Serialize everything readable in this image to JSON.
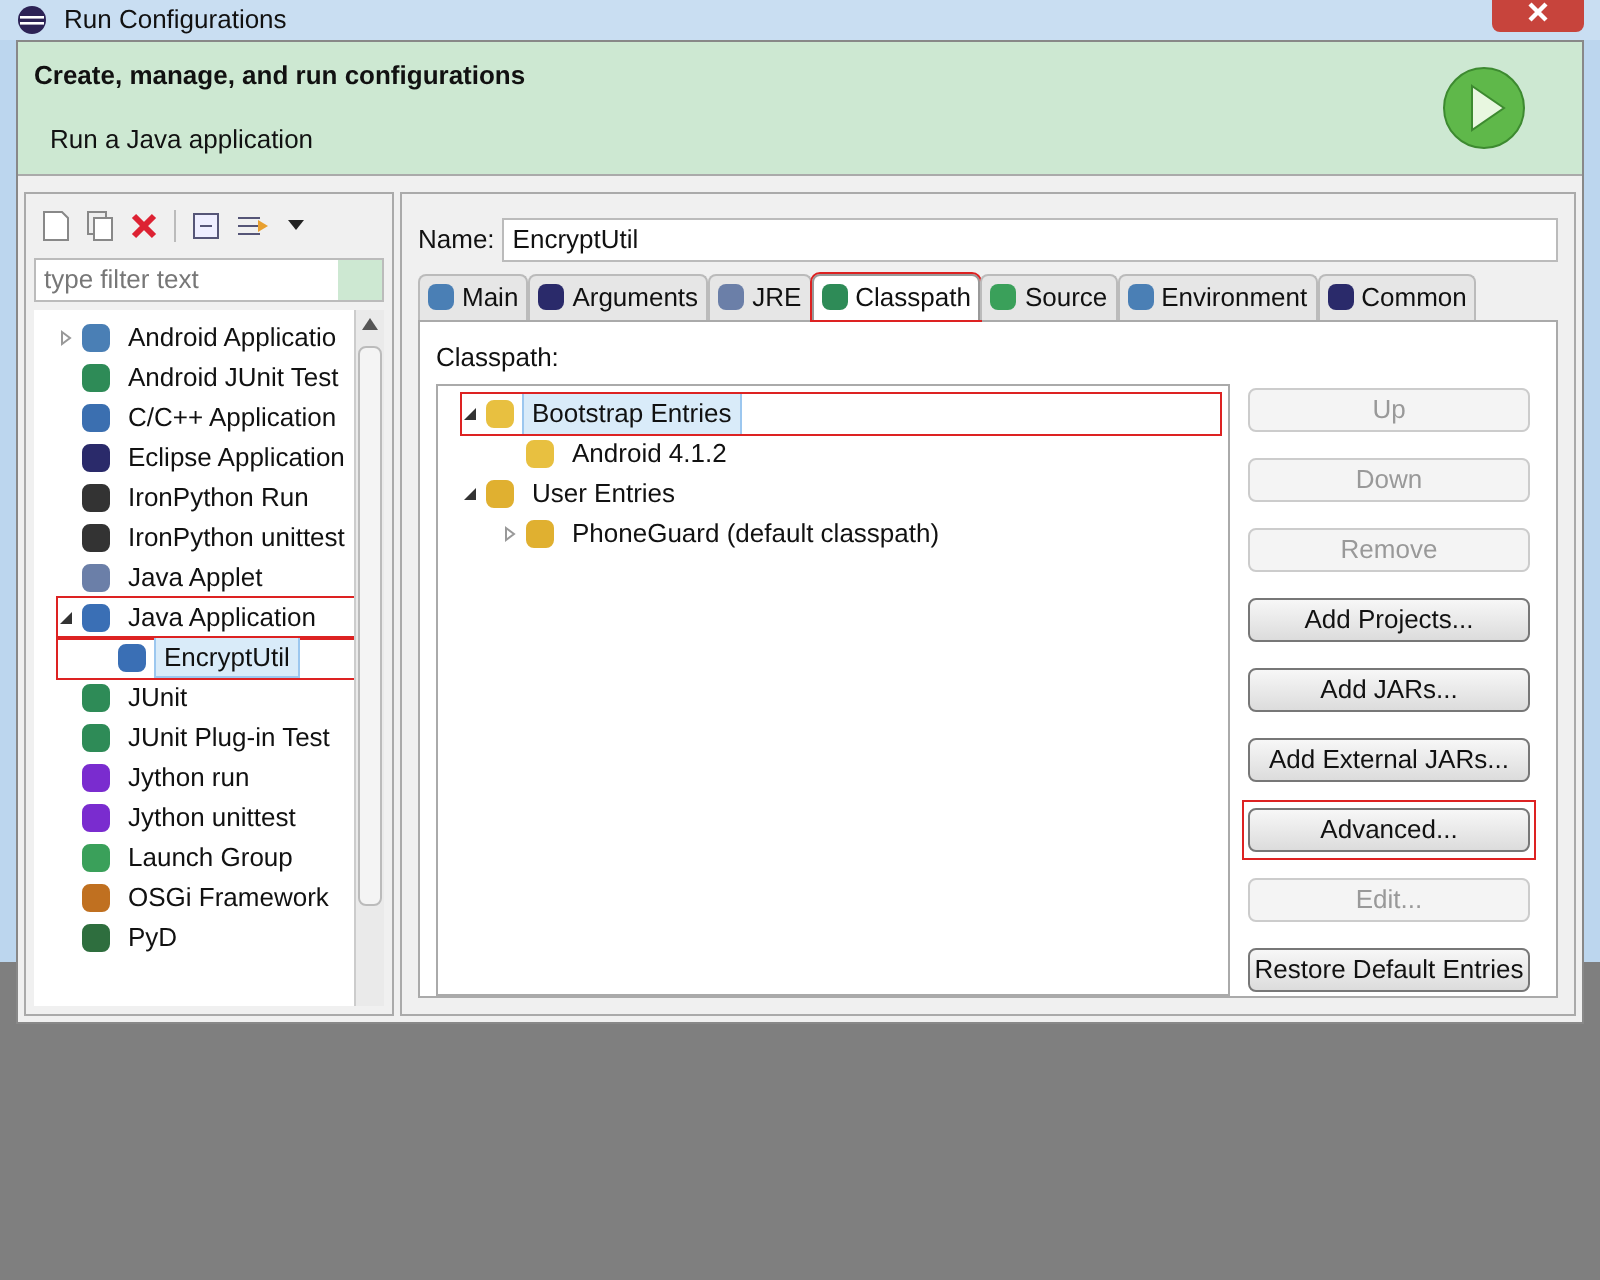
{
  "window": {
    "title": "Run Configurations"
  },
  "header": {
    "title": "Create, manage, and run configurations",
    "subtitle": "Run a Java application"
  },
  "filter": {
    "placeholder": "type filter text"
  },
  "config_tree": [
    {
      "label": "Android Applicatio",
      "expanded": false,
      "selected": false,
      "highlighted": false
    },
    {
      "label": "Android JUnit Test",
      "selected": false,
      "highlighted": false
    },
    {
      "label": "C/C++ Application",
      "selected": false,
      "highlighted": false
    },
    {
      "label": "Eclipse Application",
      "selected": false,
      "highlighted": false
    },
    {
      "label": "IronPython Run",
      "selected": false,
      "highlighted": false
    },
    {
      "label": "IronPython unittest",
      "selected": false,
      "highlighted": false
    },
    {
      "label": "Java Applet",
      "selected": false,
      "highlighted": false
    },
    {
      "label": "Java Application",
      "expanded": true,
      "selected": false,
      "highlighted": true,
      "children": [
        {
          "label": "EncryptUtil",
          "selected": true,
          "highlighted": true
        }
      ]
    },
    {
      "label": "JUnit",
      "selected": false,
      "highlighted": false
    },
    {
      "label": "JUnit Plug-in Test",
      "selected": false,
      "highlighted": false
    },
    {
      "label": "Jython run",
      "selected": false,
      "highlighted": false
    },
    {
      "label": "Jython unittest",
      "selected": false,
      "highlighted": false
    },
    {
      "label": "Launch Group",
      "selected": false,
      "highlighted": false
    },
    {
      "label": "OSGi Framework",
      "selected": false,
      "highlighted": false
    },
    {
      "label": "PyD",
      "selected": false,
      "highlighted": false
    }
  ],
  "name_field": {
    "label": "Name:",
    "value": "EncryptUtil"
  },
  "tabs": [
    {
      "label": "Main",
      "selected": false,
      "highlighted": false
    },
    {
      "label": "Arguments",
      "selected": false,
      "highlighted": false
    },
    {
      "label": "JRE",
      "selected": false,
      "highlighted": false
    },
    {
      "label": "Classpath",
      "selected": true,
      "highlighted": true
    },
    {
      "label": "Source",
      "selected": false,
      "highlighted": false
    },
    {
      "label": "Environment",
      "selected": false,
      "highlighted": false
    },
    {
      "label": "Common",
      "selected": false,
      "highlighted": false
    }
  ],
  "classpath_label": "Classpath:",
  "classpath_tree": [
    {
      "label": "Bootstrap Entries",
      "expanded": true,
      "selected": true,
      "highlighted": true,
      "children": [
        {
          "label": "Android 4.1.2",
          "selected": false,
          "highlighted": false
        }
      ]
    },
    {
      "label": "User Entries",
      "expanded": true,
      "selected": false,
      "highlighted": false,
      "children": [
        {
          "label": "PhoneGuard (default classpath)",
          "expanded": false,
          "selected": false,
          "highlighted": false
        }
      ]
    }
  ],
  "buttons": [
    {
      "label": "Up",
      "disabled": true,
      "highlighted": false
    },
    {
      "label": "Down",
      "disabled": true,
      "highlighted": false
    },
    {
      "label": "Remove",
      "disabled": true,
      "highlighted": false
    },
    {
      "label": "Add Projects...",
      "disabled": false,
      "highlighted": false
    },
    {
      "label": "Add JARs...",
      "disabled": false,
      "highlighted": false
    },
    {
      "label": "Add External JARs...",
      "disabled": false,
      "highlighted": false
    },
    {
      "label": "Advanced...",
      "disabled": false,
      "highlighted": true
    },
    {
      "label": "Edit...",
      "disabled": true,
      "highlighted": false
    },
    {
      "label": "Restore Default Entries",
      "disabled": false,
      "highlighted": false
    }
  ]
}
